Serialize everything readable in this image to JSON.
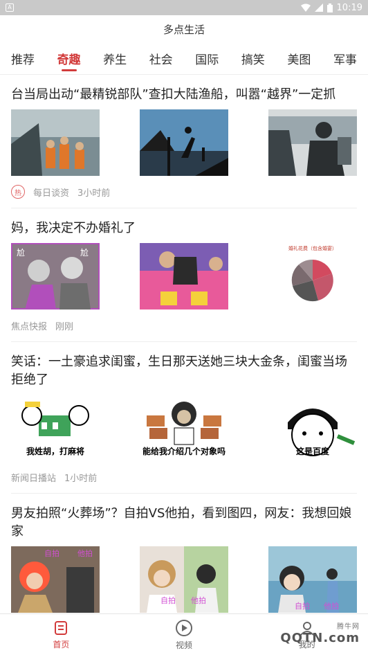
{
  "status_bar": {
    "time": "10:19",
    "app_icon": "A"
  },
  "header": {
    "title": "多点生活"
  },
  "tabs": [
    "推荐",
    "奇趣",
    "养生",
    "社会",
    "国际",
    "搞笑",
    "美图",
    "军事"
  ],
  "articles": [
    {
      "title": "台当局出动“最精锐部队”查扣大陆渔船，叫嚣“越界”一定抓",
      "hot_badge": "热",
      "source": "每日谈资",
      "time": "3小时前"
    },
    {
      "title": "妈，我决定不办婚礼了",
      "source": "焦点快报",
      "time": "刚刚",
      "pie_title": "婚礼花费（包含婚宴）"
    },
    {
      "title": "笑话：一土豪追求闺蜜，生日那天送她三块大金条，闺蜜当场拒绝了",
      "source": "新闻日播站",
      "time": "1小时前",
      "captions": [
        "我姓胡，打麻将",
        "能给我介绍几个对象吗",
        "这是百度"
      ]
    },
    {
      "title": "男友拍照“火葬场”？自拍VS他拍，看到图四，网友：我想回娘家",
      "labels": [
        "自拍",
        "他拍"
      ]
    }
  ],
  "bottom_nav": [
    {
      "label": "首页",
      "icon": "home-icon"
    },
    {
      "label": "视频",
      "icon": "video-play-icon"
    },
    {
      "label": "我的",
      "icon": "profile-icon"
    }
  ],
  "watermark": {
    "text": "QQTN.com",
    "sub": "腾牛网"
  }
}
